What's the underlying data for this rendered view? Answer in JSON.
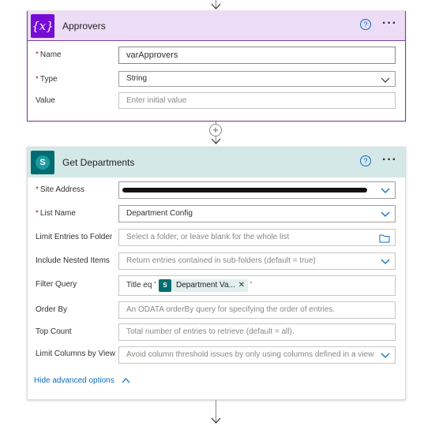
{
  "approvers_card": {
    "title": "Approvers",
    "icon": "variable-icon",
    "fields": [
      {
        "label": "Name",
        "required": true,
        "value": "varApprovers"
      },
      {
        "label": "Type",
        "required": true,
        "value": "String"
      },
      {
        "label": "Value",
        "required": false,
        "placeholder": "Enter initial value"
      }
    ]
  },
  "departments_card": {
    "title": "Get Departments",
    "icon": "sharepoint-icon",
    "fields": {
      "site_address": {
        "label": "Site Address",
        "required": true
      },
      "list_name": {
        "label": "List Name",
        "required": true,
        "value": "Department Config"
      },
      "limit_folder": {
        "label": "Limit Entries to Folder",
        "placeholder": "Select a folder, or leave blank for the whole list"
      },
      "nested": {
        "label": "Include Nested Items",
        "placeholder": "Return entries contained in sub-folders (default = true)"
      },
      "filter": {
        "label": "Filter Query",
        "prefix": "Title eq '",
        "token": "Department Va...",
        "suffix": "'"
      },
      "order_by": {
        "label": "Order By",
        "placeholder": "An ODATA orderBy query for specifying the order of entries."
      },
      "top_count": {
        "label": "Top Count",
        "placeholder": "Total number of entries to retrieve (default = all)."
      },
      "limit_columns": {
        "label": "Limit Columns by View",
        "placeholder": "Avoid column threshold issues by only using columns defined in a view"
      }
    },
    "hide_advanced": "Hide advanced options"
  },
  "colors": {
    "variable_accent": "#770bd6",
    "sharepoint_accent": "#036c70",
    "link": "#0f6cbd"
  }
}
